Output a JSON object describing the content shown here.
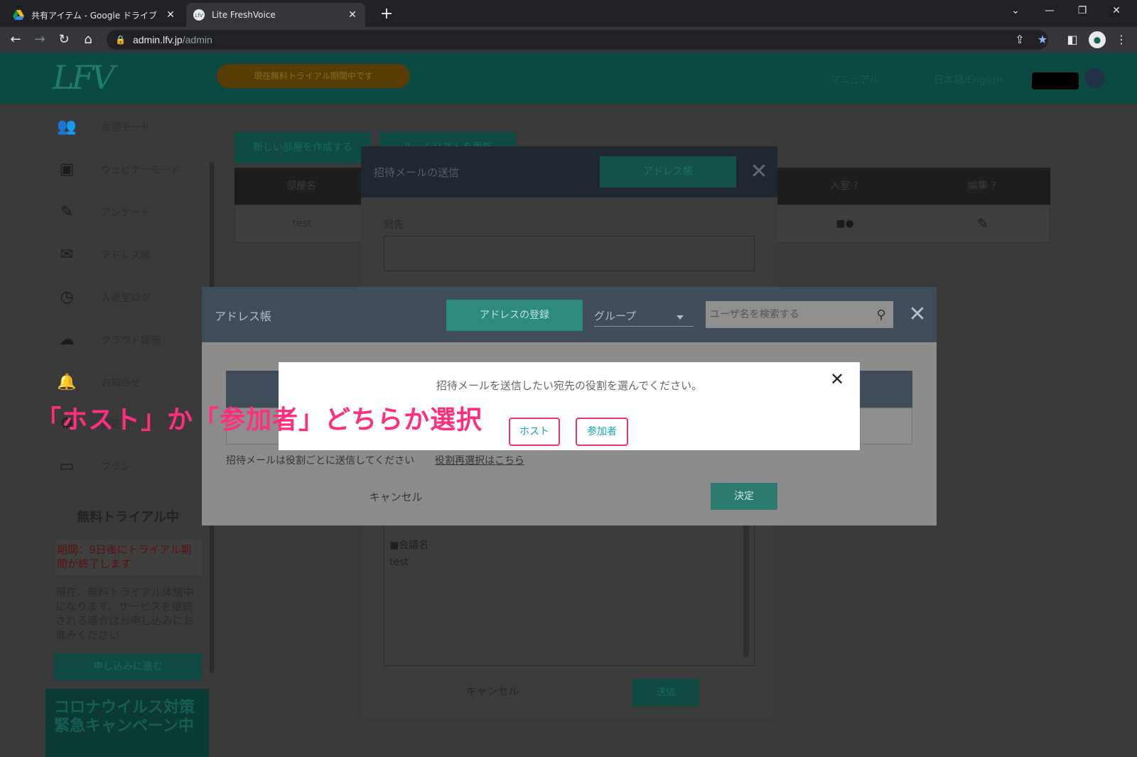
{
  "browser": {
    "tabs": [
      {
        "title": "共有アイテム - Google ドライブ",
        "active": false
      },
      {
        "title": "Lite FreshVoice",
        "active": true
      }
    ],
    "url_host": "admin.lfv.jp",
    "url_path": "/admin"
  },
  "app": {
    "logo": "LFV",
    "trial_banner": "現在無料トライアル期間中です",
    "header_links": [
      "マニュアル",
      "日本語/English"
    ],
    "sidebar": [
      {
        "label": "会議モード",
        "icon": "users-icon"
      },
      {
        "label": "ウェビナーモード",
        "icon": "presenter-icon"
      },
      {
        "label": "アンケート",
        "icon": "edit-icon"
      },
      {
        "label": "アドレス帳",
        "icon": "mail-icon"
      },
      {
        "label": "入退室ログ",
        "icon": "history-icon"
      },
      {
        "label": "クラウド録画",
        "icon": "cloud-icon"
      },
      {
        "label": "お知らせ",
        "icon": "bell-icon"
      },
      {
        "label": "設定",
        "icon": "gear-icon"
      },
      {
        "label": "プラン",
        "icon": "card-icon"
      }
    ],
    "trial_box": {
      "title": "無料トライアル中",
      "warning": "期間：9日後にトライアル期間が終了します",
      "text": "現在、無料トライアル体験中になります。サービスを継続される場合はお申し込みにお進みください",
      "apply_button": "申し込みに進む"
    },
    "campaign": "コロナウイルス対策緊急キャンペーン中",
    "main_buttons": [
      "新しい部屋を作成する",
      "ルームリストを更新"
    ],
    "table": {
      "headers": [
        "部屋名",
        "入室",
        "編集"
      ],
      "row": {
        "name": "test"
      }
    }
  },
  "invite_modal": {
    "title": "招待メールの送信",
    "address_book_button": "アドレス帳",
    "to_label": "宛先",
    "body_heading": "■会議名",
    "body_value": "test",
    "cancel": "キャンセル",
    "send": "送信"
  },
  "address_modal": {
    "title": "アドレス帳",
    "register_button": "アドレスの登録",
    "group_select": "グループ",
    "search_placeholder": "ユーザ名を検索する",
    "note": "招待メールは役割ごとに送信してください",
    "reselect_link": "役割再選択はこちら",
    "cancel": "キャンセル",
    "confirm": "決定"
  },
  "role_dialog": {
    "message": "招待メールを送信したい宛先の役割を選んでください。",
    "host_button": "ホスト",
    "participant_button": "参加者"
  },
  "annotation": "「ホスト」か「参加者」どちらか選択",
  "colors": {
    "accent_pink": "#ff2e7e",
    "teal": "#2e8a7e",
    "role_text": "#1aa6b7"
  }
}
